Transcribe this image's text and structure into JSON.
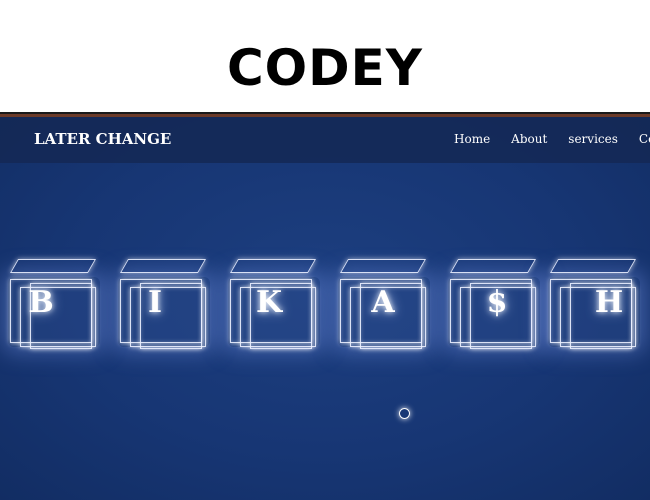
{
  "banner": {
    "title": "CODEY"
  },
  "navbar": {
    "brand": "LATER CHANGE",
    "links": [
      "Home",
      "About",
      "services",
      "Contac"
    ]
  },
  "hero": {
    "letters": [
      "B",
      "I",
      "K",
      "A",
      "$",
      "H"
    ]
  },
  "colors": {
    "site_background": "#173674",
    "navbar_background": "#142855",
    "text": "#ffffff"
  }
}
